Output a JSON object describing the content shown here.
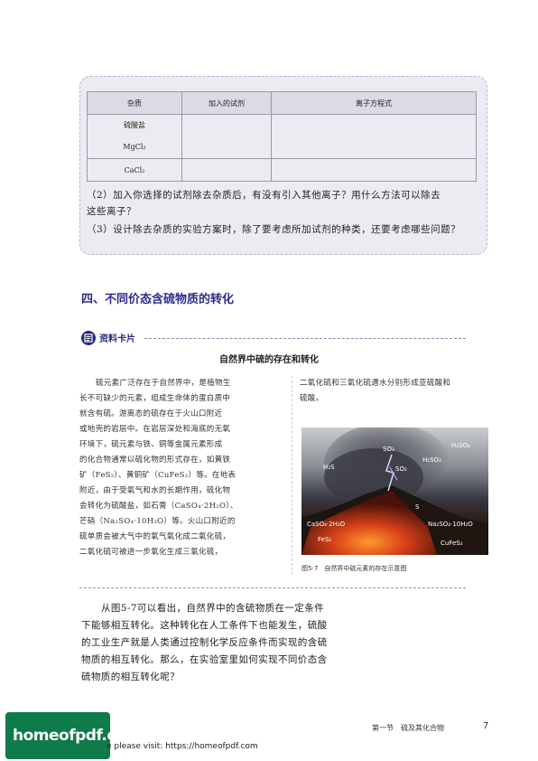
{
  "activity": {
    "table": {
      "headers": [
        "杂质",
        "加入的试剂",
        "离子方程式"
      ],
      "rows": [
        {
          "impurity_lines": [
            "硫酸盐",
            "MgCl₂"
          ]
        },
        {
          "impurity_lines": [
            "CaCl₂"
          ]
        }
      ]
    },
    "q2_line1": "（2）加入你选择的试剂除去杂质后，有没有引入其他离子？用什么方法可以除去",
    "q2_line2": "这些离子？",
    "q3": "（3）设计除去杂质的实验方案时，除了要考虑所加试剂的种类，还要考虑哪些问题？"
  },
  "section": {
    "heading": "四、不同价态含硫物质的转化"
  },
  "card": {
    "label": "资料卡片",
    "title": "自然界中硫的存在和转化",
    "left_lines": [
      "硫元素广泛存在于自然界中，是植物生",
      "长不可缺少的元素，组成生命体的蛋白质中",
      "就含有硫。游离态的硫存在于火山口附近",
      "或地壳的岩层中。在岩层深处和海底的无氧",
      "环境下，硫元素与铁、铜等金属元素形成",
      "的化合物通常以硫化物的形式存在，如黄铁",
      "矿（FeS₂）、黄铜矿（CuFeS₂）等。在地表",
      "附近，由于受氧气和水的长期作用，硫化物",
      "会转化为硫酸盐，如石膏（CaSO₄·2H₂O）、",
      "芒硝（Na₂SO₄·10H₂O）等。火山口附近的",
      "硫单质会被大气中的氧气氧化成二氧化硫，",
      "二氧化硫可被进一步氧化生成三氧化硫，"
    ],
    "right_lines": [
      "二氧化硫和三氧化硫遇水分别形成亚硫酸和",
      "硫酸。"
    ],
    "photo_labels": {
      "so3": "SO₃",
      "h2so4": "H₂SO₄",
      "h2s": "H₂S",
      "so2": "SO₂",
      "h2so3": "H₂SO₃",
      "s": "S",
      "caso4": "CaSO₄·2H₂O",
      "na2so4": "Na₂SO₄·10H₂O",
      "fes2": "FeS₂",
      "cufes2": "CuFeS₂"
    },
    "figure_caption": "图5-7　自然界中硫元素的存在示意图"
  },
  "paragraph": [
    "从图5-7可以看出，自然界中的含硫物质在一定条件",
    "下能够相互转化。这种转化在人工条件下也能发生，硫酸",
    "的工业生产就是人类通过控制化学反应条件而实现的含硫",
    "物质的相互转化。那么，在实验室里如何实现不同价态含",
    "硫物质的相互转化呢？"
  ],
  "footer": {
    "section": "第一节　硫及其化合物",
    "page": "7"
  },
  "watermark": {
    "logo": "homeofpdf.com",
    "url": "e please visit: https://homeofpdf.com"
  }
}
